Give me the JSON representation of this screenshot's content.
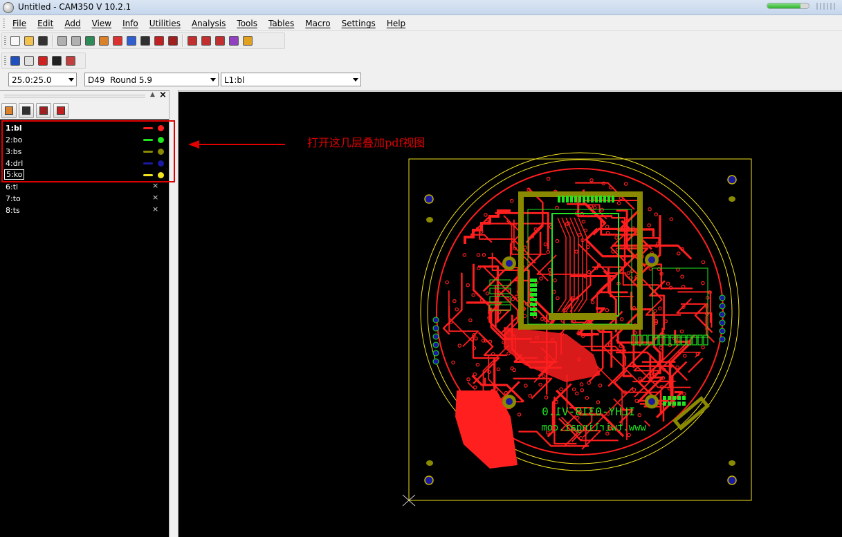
{
  "window": {
    "title": "Untitled - CAM350 V 10.2.1",
    "progress_fraction": 0.8
  },
  "menu": [
    "File",
    "Edit",
    "Add",
    "View",
    "Info",
    "Utilities",
    "Analysis",
    "Tools",
    "Tables",
    "Macro",
    "Settings",
    "Help"
  ],
  "toolbar_main": [
    {
      "icon": "new-file-icon",
      "color": "#f7f7f7"
    },
    {
      "icon": "open-folder-icon",
      "color": "#f2c14e"
    },
    {
      "icon": "save-icon",
      "color": "#333333"
    },
    {
      "icon": "sep"
    },
    {
      "icon": "undo-icon",
      "color": "#b0b0b0"
    },
    {
      "icon": "redo-icon",
      "color": "#b0b0b0"
    },
    {
      "icon": "redraw-icon",
      "color": "#2e8b57"
    },
    {
      "icon": "erase-icon",
      "color": "#d9822b"
    },
    {
      "icon": "zoom-window-icon",
      "color": "#d93030"
    },
    {
      "icon": "zoom-out-icon",
      "color": "#3060d0"
    },
    {
      "icon": "zoom-all-icon",
      "color": "#303030"
    },
    {
      "icon": "snap-icon",
      "color": "#c02020"
    },
    {
      "icon": "layers-icon",
      "color": "#a02020"
    },
    {
      "icon": "sep"
    },
    {
      "icon": "grid-icon",
      "color": "#c03030"
    },
    {
      "icon": "dot-grid-icon",
      "color": "#c03030"
    },
    {
      "icon": "pad-grid-icon",
      "color": "#c03030"
    },
    {
      "icon": "color-icon",
      "color": "#9040c0"
    },
    {
      "icon": "highlight-icon",
      "color": "#e0a020"
    }
  ],
  "toolbar_edit": [
    {
      "icon": "move-icon",
      "color": "#2050c0"
    },
    {
      "icon": "copy-icon",
      "color": "#e0e0e0"
    },
    {
      "icon": "delete-icon",
      "color": "#d02020"
    },
    {
      "icon": "rotate-icon",
      "color": "#202020"
    },
    {
      "icon": "mirror-icon",
      "color": "#c04040"
    }
  ],
  "combos": {
    "zoom": "25.0:25.0",
    "dcode": "D49  Round 5.9",
    "layer": "L1:bl"
  },
  "panel_tools": [
    {
      "icon": "edit-layer-icon",
      "color": "#d9822b"
    },
    {
      "icon": "add-layer-icon",
      "color": "#303030"
    },
    {
      "icon": "layer-stack-icon",
      "color": "#a02020"
    },
    {
      "icon": "layer-settings-icon",
      "color": "#c02020"
    }
  ],
  "layers": [
    {
      "label": "1:bl",
      "color": "#ff1f1f",
      "visible": true,
      "active": true
    },
    {
      "label": "2:bo",
      "color": "#1fe61f",
      "visible": true
    },
    {
      "label": "3:bs",
      "color": "#8a8a00",
      "visible": true
    },
    {
      "label": "4:drl",
      "color": "#1a1aa0",
      "visible": true
    },
    {
      "label": "5:ko",
      "color": "#f2e21f",
      "visible": true,
      "focused": true
    },
    {
      "label": "6:tl",
      "visible": false
    },
    {
      "label": "7:to",
      "visible": false
    },
    {
      "label": "8:ts",
      "visible": false
    }
  ],
  "hidden_mark": "×",
  "annotation": "打开这几层叠加pdf视图",
  "board_silkscreen": {
    "line1": "ILHY-0318-V1.0",
    "line2": "www.twirlingai.com"
  },
  "colors": {
    "copper": "#ff1f1f",
    "silk": "#1fe61f",
    "mask": "#8a8a00",
    "drill": "#1a1aa0",
    "outline": "#f2e21f",
    "annotation": "#e00000"
  }
}
